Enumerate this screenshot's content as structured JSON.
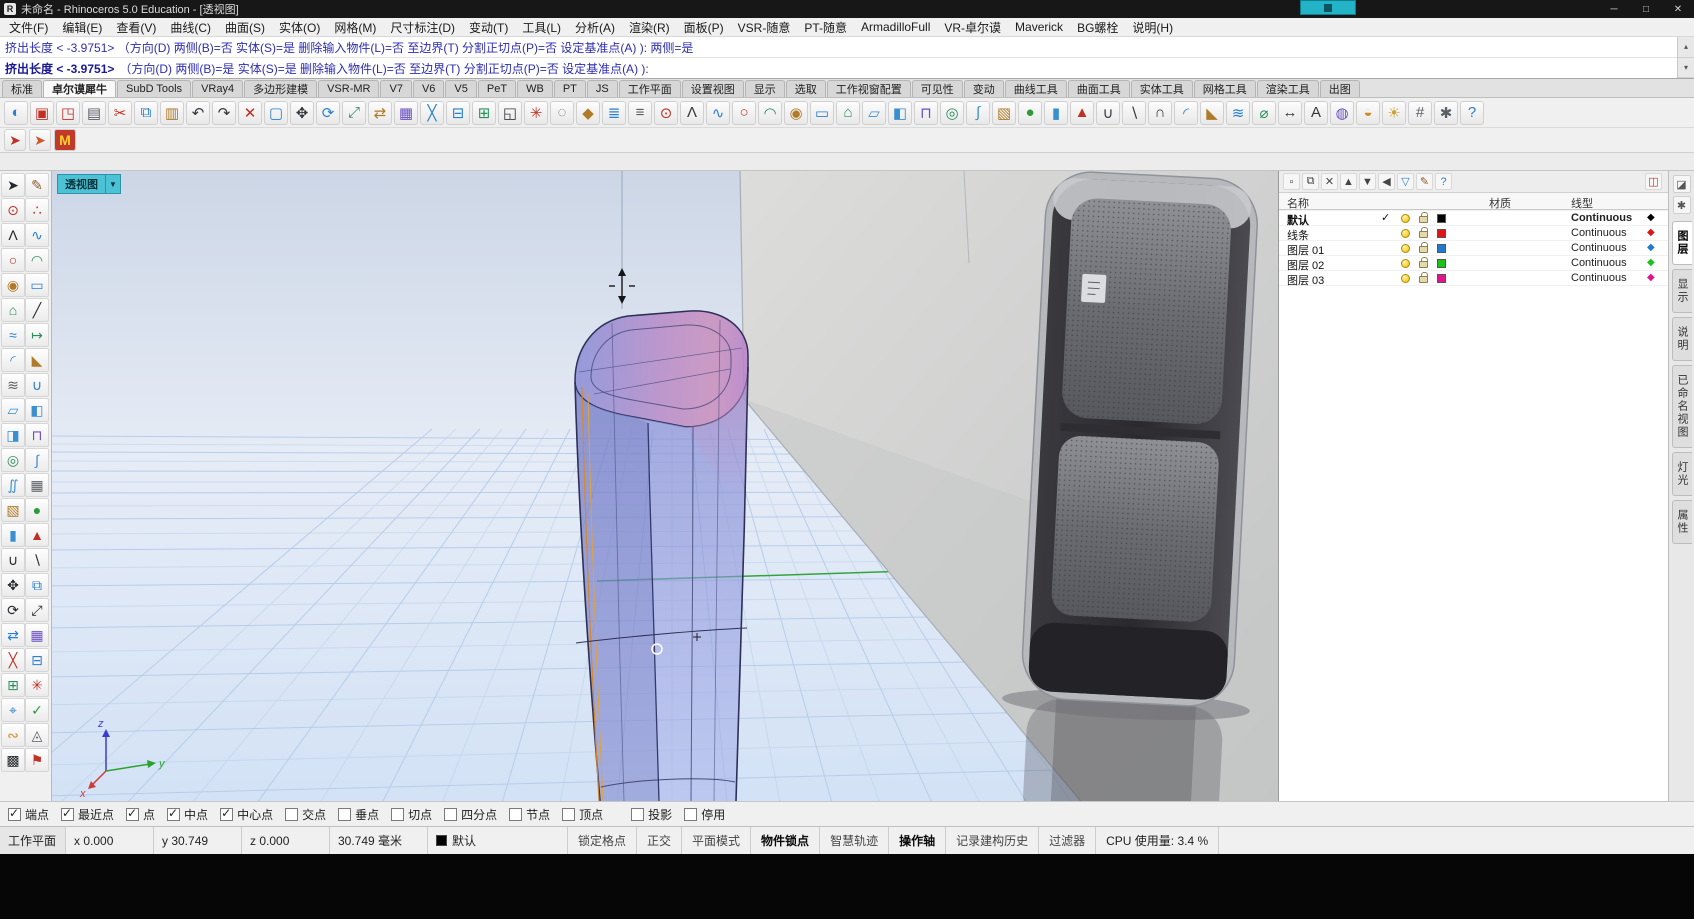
{
  "window": {
    "title": "未命名 - Rhinoceros 5.0 Education - [透视图]",
    "app_icon": "R",
    "controls": {
      "minimize": "─",
      "maximize": "□",
      "close": "✕"
    }
  },
  "menu": {
    "items": [
      "文件(F)",
      "编辑(E)",
      "查看(V)",
      "曲线(C)",
      "曲面(S)",
      "实体(O)",
      "网格(M)",
      "尺寸标注(D)",
      "变动(T)",
      "工具(L)",
      "分析(A)",
      "渲染(R)",
      "面板(P)",
      "VSR-随意",
      "PT-随意",
      "ArmadilloFull",
      "VR-卓尔谟",
      "Maverick",
      "BG螺栓",
      "说明(H)"
    ]
  },
  "command": {
    "line1": "挤出长度 < -3.9751> （方向(D) 两侧(B)=否 实体(S)=是 删除输入物件(L)=否 至边界(T) 分割正切点(P)=否 设定基准点(A) ): 两侧=是",
    "line2_prompt": "挤出长度 < -3.9751>",
    "line2_options": "（方向(D) 两侧(B)=是 实体(S)=是 删除输入物件(L)=否 至边界(T) 分割正切点(P)=否 设定基准点(A) ):"
  },
  "tabbar": {
    "tabs": [
      {
        "label": "标准"
      },
      {
        "label": "卓尔谟犀牛",
        "active": true
      },
      {
        "label": "SubD Tools"
      },
      {
        "label": "VRay4"
      },
      {
        "label": "多边形建模"
      },
      {
        "label": "VSR-MR"
      },
      {
        "label": "V7"
      },
      {
        "label": "V6"
      },
      {
        "label": "V5"
      },
      {
        "label": "PeT"
      },
      {
        "label": "WB"
      },
      {
        "label": "PT"
      },
      {
        "label": "JS"
      },
      {
        "label": "工作平面"
      },
      {
        "label": "设置视图"
      },
      {
        "label": "显示"
      },
      {
        "label": "选取"
      },
      {
        "label": "工作视窗配置"
      },
      {
        "label": "可见性"
      },
      {
        "label": "变动"
      },
      {
        "label": "曲线工具"
      },
      {
        "label": "曲面工具"
      },
      {
        "label": "实体工具"
      },
      {
        "label": "网格工具"
      },
      {
        "label": "渲染工具"
      },
      {
        "label": "出图"
      }
    ]
  },
  "toolbar": {
    "icons": [
      {
        "name": "cplane-view-icon",
        "glyph": "◐",
        "color": "#2a7fd0"
      },
      {
        "name": "save-icon",
        "glyph": "▣",
        "color": "#c03024"
      },
      {
        "name": "export-icon",
        "glyph": "◳",
        "color": "#c03024"
      },
      {
        "name": "print-icon",
        "glyph": "▤",
        "color": "#5a5f66"
      },
      {
        "name": "cut-icon",
        "glyph": "✂",
        "color": "#c03024"
      },
      {
        "name": "copy-icon",
        "glyph": "⧉",
        "color": "#2a7fd0"
      },
      {
        "name": "paste-icon",
        "glyph": "▥",
        "color": "#b07a28"
      },
      {
        "name": "undo-icon",
        "glyph": "↶",
        "color": "#33383e"
      },
      {
        "name": "redo-icon",
        "glyph": "↷",
        "color": "#33383e"
      },
      {
        "name": "delete-icon",
        "glyph": "✕",
        "color": "#c03024"
      },
      {
        "name": "select-all-icon",
        "glyph": "▢",
        "color": "#2a7fd0"
      },
      {
        "name": "move-icon",
        "glyph": "✥",
        "color": "#33383e"
      },
      {
        "name": "rotate-icon",
        "glyph": "⟳",
        "color": "#2a7fd0"
      },
      {
        "name": "scale-icon",
        "glyph": "⤢",
        "color": "#2a8f5a"
      },
      {
        "name": "mirror-icon",
        "glyph": "⇄",
        "color": "#b07a28"
      },
      {
        "name": "array-icon",
        "glyph": "▦",
        "color": "#6a4fc0"
      },
      {
        "name": "trim-icon",
        "glyph": "╳",
        "color": "#2a7fd0"
      },
      {
        "name": "split-icon",
        "glyph": "⊟",
        "color": "#2a7fd0"
      },
      {
        "name": "join-icon",
        "glyph": "⊞",
        "color": "#2a8f5a"
      },
      {
        "name": "group-icon",
        "glyph": "◱",
        "color": "#33383e"
      },
      {
        "name": "explode-icon",
        "glyph": "✳",
        "color": "#c03024"
      },
      {
        "name": "hide-icon",
        "glyph": "◌",
        "color": "#5a5f66"
      },
      {
        "name": "lock-icon",
        "glyph": "◆",
        "color": "#b07a28"
      },
      {
        "name": "layers-icon",
        "glyph": "≣",
        "color": "#2a7fd0"
      },
      {
        "name": "properties-icon",
        "glyph": "≡",
        "color": "#5a5f66"
      },
      {
        "name": "point-icon",
        "glyph": "⊙",
        "color": "#c03024"
      },
      {
        "name": "polyline-icon",
        "glyph": "Λ",
        "color": "#33383e"
      },
      {
        "name": "curve-icon",
        "glyph": "∿",
        "color": "#2a7fd0"
      },
      {
        "name": "circle-icon",
        "glyph": "○",
        "color": "#c03024"
      },
      {
        "name": "arc-icon",
        "glyph": "◠",
        "color": "#2a8f5a"
      },
      {
        "name": "ellipse-icon",
        "glyph": "◉",
        "color": "#b07a28"
      },
      {
        "name": "rectangle-icon",
        "glyph": "▭",
        "color": "#2a7fd0"
      },
      {
        "name": "polygon-icon",
        "glyph": "⌂",
        "color": "#2a8f5a"
      },
      {
        "name": "surface-icon",
        "glyph": "▱",
        "color": "#3a8fd0"
      },
      {
        "name": "loft-icon",
        "glyph": "◧",
        "color": "#3a8fd0"
      },
      {
        "name": "extrude-icon",
        "glyph": "⊓",
        "color": "#6a4fc0"
      },
      {
        "name": "revolve-icon",
        "glyph": "◎",
        "color": "#2a8f5a"
      },
      {
        "name": "sweep-icon",
        "glyph": "∫",
        "color": "#3a8fd0"
      },
      {
        "name": "box-icon",
        "glyph": "▧",
        "color": "#b07a28"
      },
      {
        "name": "sphere-icon",
        "glyph": "●",
        "color": "#2a9a3a"
      },
      {
        "name": "cylinder-icon",
        "glyph": "▮",
        "color": "#3a8fd0"
      },
      {
        "name": "cone-icon",
        "glyph": "▲",
        "color": "#c03024"
      },
      {
        "name": "boolean-union-icon",
        "glyph": "∪",
        "color": "#33383e"
      },
      {
        "name": "boolean-difference-icon",
        "glyph": "∖",
        "color": "#33383e"
      },
      {
        "name": "boolean-intersection-icon",
        "glyph": "∩",
        "color": "#33383e"
      },
      {
        "name": "fillet-icon",
        "glyph": "◜",
        "color": "#2a7fd0"
      },
      {
        "name": "chamfer-icon",
        "glyph": "◣",
        "color": "#b07a28"
      },
      {
        "name": "offset-icon",
        "glyph": "≋",
        "color": "#2a7fd0"
      },
      {
        "name": "analyze-icon",
        "glyph": "⌀",
        "color": "#2a8f5a"
      },
      {
        "name": "dimension-icon",
        "glyph": "↔",
        "color": "#33383e"
      },
      {
        "name": "text-icon",
        "glyph": "A",
        "color": "#33383e"
      },
      {
        "name": "render-icon",
        "glyph": "◍",
        "color": "#6a4fc0"
      },
      {
        "name": "material-icon",
        "glyph": "◒",
        "color": "#d08a2a"
      },
      {
        "name": "sun-icon",
        "glyph": "☀",
        "color": "#d0a22a"
      },
      {
        "name": "grid-icon",
        "glyph": "#",
        "color": "#5a5f66"
      },
      {
        "name": "options-icon",
        "glyph": "✱",
        "color": "#5a5f66"
      },
      {
        "name": "help-icon",
        "glyph": "?",
        "color": "#2a7fd0"
      }
    ]
  },
  "subtoolbar": {
    "icons": [
      {
        "name": "vsr-pointer-icon",
        "glyph": "➤",
        "color": "#c03024"
      },
      {
        "name": "vsr-pointer-alt-icon",
        "glyph": "➤",
        "color": "#d0542a"
      },
      {
        "name": "maverick-logo-icon",
        "glyph": "M",
        "color": "#ffd02a",
        "bg": "#c0392a"
      }
    ]
  },
  "left_toolbar": {
    "icons": [
      {
        "name": "select-pointer-icon",
        "glyph": "➤",
        "color": "#23282e"
      },
      {
        "name": "lasso-select-icon",
        "glyph": "✎",
        "color": "#8a5a2a"
      },
      {
        "name": "point-icon",
        "glyph": "⊙",
        "color": "#c03024"
      },
      {
        "name": "point-cloud-icon",
        "glyph": "∴",
        "color": "#c03024"
      },
      {
        "name": "polyline-icon",
        "glyph": "Λ",
        "color": "#23282e"
      },
      {
        "name": "freeform-curve-icon",
        "glyph": "∿",
        "color": "#2a7fd0"
      },
      {
        "name": "circle-icon",
        "glyph": "○",
        "color": "#c03024"
      },
      {
        "name": "arc-icon",
        "glyph": "◠",
        "color": "#2a8f5a"
      },
      {
        "name": "ellipse-icon",
        "glyph": "◉",
        "color": "#b07a28"
      },
      {
        "name": "rectangle-icon",
        "glyph": "▭",
        "color": "#2a7fd0"
      },
      {
        "name": "polygon-icon",
        "glyph": "⌂",
        "color": "#2a8f5a"
      },
      {
        "name": "line-icon",
        "glyph": "╱",
        "color": "#23282e"
      },
      {
        "name": "curve-tools-icon",
        "glyph": "≈",
        "color": "#2a7fd0"
      },
      {
        "name": "extend-curve-icon",
        "glyph": "↦",
        "color": "#2a8f5a"
      },
      {
        "name": "fillet-curve-icon",
        "glyph": "◜",
        "color": "#2a7fd0"
      },
      {
        "name": "chamfer-curve-icon",
        "glyph": "◣",
        "color": "#b07a28"
      },
      {
        "name": "offset-curve-icon",
        "glyph": "≋",
        "color": "#5a5f66"
      },
      {
        "name": "blend-curve-icon",
        "glyph": "∪",
        "color": "#2a7fd0"
      },
      {
        "name": "plane-surface-icon",
        "glyph": "▱",
        "color": "#3a8fd0"
      },
      {
        "name": "corner-surface-icon",
        "glyph": "◧",
        "color": "#3a8fd0"
      },
      {
        "name": "loft-icon",
        "glyph": "◨",
        "color": "#3a8fd0"
      },
      {
        "name": "extrude-icon",
        "glyph": "⊓",
        "color": "#6a4fc0"
      },
      {
        "name": "revolve-icon",
        "glyph": "◎",
        "color": "#2a8f5a"
      },
      {
        "name": "sweep1-icon",
        "glyph": "∫",
        "color": "#3a8fd0"
      },
      {
        "name": "sweep2-icon",
        "glyph": "∬",
        "color": "#3a8fd0"
      },
      {
        "name": "network-surface-icon",
        "glyph": "▦",
        "color": "#5a5f66"
      },
      {
        "name": "box-icon",
        "glyph": "▧",
        "color": "#b07a28"
      },
      {
        "name": "sphere-icon",
        "glyph": "●",
        "color": "#2a9a3a"
      },
      {
        "name": "cylinder-icon",
        "glyph": "▮",
        "color": "#3a8fd0"
      },
      {
        "name": "cone-icon",
        "glyph": "▲",
        "color": "#c03024"
      },
      {
        "name": "boolean-union-icon",
        "glyph": "∪",
        "color": "#23282e"
      },
      {
        "name": "boolean-difference-icon",
        "glyph": "∖",
        "color": "#23282e"
      },
      {
        "name": "move-icon",
        "glyph": "✥",
        "color": "#23282e"
      },
      {
        "name": "copy-icon",
        "glyph": "⧉",
        "color": "#2a7fd0"
      },
      {
        "name": "rotate-icon",
        "glyph": "⟳",
        "color": "#23282e"
      },
      {
        "name": "scale-icon",
        "glyph": "⤢",
        "color": "#23282e"
      },
      {
        "name": "mirror-icon",
        "glyph": "⇄",
        "color": "#2a7fd0"
      },
      {
        "name": "array-icon",
        "glyph": "▦",
        "color": "#6a4fc0"
      },
      {
        "name": "trim-icon",
        "glyph": "╳",
        "color": "#c03024"
      },
      {
        "name": "split-icon",
        "glyph": "⊟",
        "color": "#2a7fd0"
      },
      {
        "name": "join-icon",
        "glyph": "⊞",
        "color": "#2a8f5a"
      },
      {
        "name": "explode-icon",
        "glyph": "✳",
        "color": "#c03024"
      },
      {
        "name": "object-snap-icon",
        "glyph": "⌖",
        "color": "#2a7fd0"
      },
      {
        "name": "analyze-icon",
        "glyph": "✓",
        "color": "#2a9a3a"
      },
      {
        "name": "curvature-icon",
        "glyph": "∾",
        "color": "#d08a2a"
      },
      {
        "name": "mesh-icon",
        "glyph": "◬",
        "color": "#5a5f66"
      },
      {
        "name": "hatch-icon",
        "glyph": "▩",
        "color": "#23282e"
      },
      {
        "name": "history-icon",
        "glyph": "⚑",
        "color": "#c03024"
      }
    ]
  },
  "viewport": {
    "label": "透视图",
    "dropdown": "▼",
    "axis": {
      "x": "x",
      "y": "y",
      "z": "z"
    }
  },
  "layers_panel": {
    "toolbar": [
      {
        "name": "new-layer-icon",
        "glyph": "▫"
      },
      {
        "name": "new-sublayer-icon",
        "glyph": "⧉"
      },
      {
        "name": "delete-layer-icon",
        "glyph": "✕"
      },
      {
        "name": "move-up-icon",
        "glyph": "▲"
      },
      {
        "name": "move-down-icon",
        "glyph": "▼"
      },
      {
        "name": "match-properties-icon",
        "glyph": "◀"
      },
      {
        "name": "filter-icon",
        "glyph": "▽",
        "color": "#2a7fd0"
      },
      {
        "name": "layer-tools-icon",
        "glyph": "✎",
        "color": "#8a5a2a"
      },
      {
        "name": "help-icon",
        "glyph": "?",
        "color": "#2a7fd0"
      },
      {
        "name": "panel-options-icon",
        "glyph": "◫",
        "color": "#c03024",
        "push": true
      }
    ],
    "columns": {
      "name": "名称",
      "material": "材质",
      "linetype": "线型"
    },
    "current_mark": "✓",
    "rows": [
      {
        "name": "默认",
        "current": true,
        "color": "#000000",
        "linetype": "Continuous"
      },
      {
        "name": "线条",
        "color": "#e01414",
        "linetype": "Continuous"
      },
      {
        "name": "图层 01",
        "color": "#1f7ad0",
        "linetype": "Continuous"
      },
      {
        "name": "图层 02",
        "color": "#17c417",
        "linetype": "Continuous"
      },
      {
        "name": "图层 03",
        "color": "#e0148c",
        "linetype": "Continuous"
      }
    ]
  },
  "side_panel": {
    "icons": [
      {
        "name": "panel-stack-icon",
        "glyph": "◪"
      },
      {
        "name": "panel-star-icon",
        "glyph": "✱"
      }
    ],
    "tabs": [
      {
        "label": "图层",
        "active": true
      },
      {
        "label": "显示"
      },
      {
        "label": "说明"
      },
      {
        "label": "已命名视图"
      },
      {
        "label": "灯光"
      },
      {
        "label": "属性"
      }
    ]
  },
  "osnap": {
    "items": [
      {
        "label": "端点",
        "checked": true
      },
      {
        "label": "最近点",
        "checked": true
      },
      {
        "label": "点",
        "checked": true
      },
      {
        "label": "中点",
        "checked": true
      },
      {
        "label": "中心点",
        "checked": true
      },
      {
        "label": "交点"
      },
      {
        "label": "垂点"
      },
      {
        "label": "切点"
      },
      {
        "label": "四分点"
      },
      {
        "label": "节点"
      },
      {
        "label": "顶点"
      },
      {
        "label": "投影",
        "gap": true
      },
      {
        "label": "停用"
      }
    ]
  },
  "statusbar": {
    "cplane": "工作平面",
    "x": "x 0.000",
    "y": "y 30.749",
    "z": "z 0.000",
    "units": "30.749 毫米",
    "layer_chip": "默认",
    "toggles": [
      {
        "label": "锁定格点"
      },
      {
        "label": "正交"
      },
      {
        "label": "平面模式"
      },
      {
        "label": "物件锁点",
        "active": true
      },
      {
        "label": "智慧轨迹"
      },
      {
        "label": "操作轴",
        "active": true
      },
      {
        "label": "记录建构历史"
      },
      {
        "label": "过滤器"
      }
    ],
    "cpu": "CPU 使用量: 3.4 %"
  },
  "colors": {
    "viewport_label_bg": "#4cc3d4",
    "command_text": "#2d2db4",
    "recorder_badge": "#23b3c7"
  }
}
